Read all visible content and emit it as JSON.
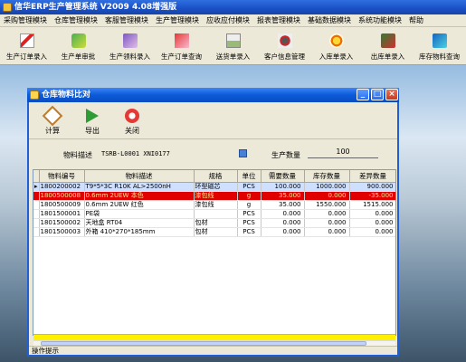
{
  "app": {
    "title": "信华ERP生产管理系统  V2009 4.08增强版"
  },
  "menu": [
    "采购管理模块",
    "仓库管理模块",
    "客服管理模块",
    "生产管理模块",
    "应收应付模块",
    "报表管理模块",
    "基础数据模块",
    "系统功能模块",
    "帮助"
  ],
  "toolbar": [
    {
      "label": "生产订单录入",
      "icon": "document-pen-icon"
    },
    {
      "label": "生产单审批",
      "icon": "approve-icon"
    },
    {
      "label": "生产领料录入",
      "icon": "material-icon"
    },
    {
      "label": "生产订单查询",
      "icon": "order-search-icon"
    },
    {
      "label": "送货单录入",
      "icon": "delivery-icon"
    },
    {
      "label": "客户信息管理",
      "icon": "customer-icon"
    },
    {
      "label": "入库单录入",
      "icon": "inbound-icon"
    },
    {
      "label": "出库单录入",
      "icon": "outbound-icon"
    },
    {
      "label": "库存物料查询",
      "icon": "inventory-search-icon"
    }
  ],
  "window": {
    "title": "仓库物料比对",
    "buttons": {
      "calc": "计算",
      "export": "导出",
      "close": "关闭"
    },
    "filter": {
      "label": "物料描述",
      "value": "TSRB-L0001    XNI0177",
      "qty_label": "生产数量",
      "qty_value": "100"
    },
    "columns": [
      "物料编号",
      "物料描述",
      "规格",
      "单位",
      "需要数量",
      "库存数量",
      "差异数量"
    ],
    "rows": [
      [
        "1800200002",
        "T9*5*3C  R10K    AL>2500nH",
        "环型磁芯",
        "PCS",
        "100.000",
        "1000.000",
        "900.000"
      ],
      [
        "1800500008",
        "0.6mm   2UEW  本色",
        "漆包线",
        "g",
        "35.000",
        "0.000",
        "-35.000"
      ],
      [
        "1800500009",
        "0.6mm   2UEW  红色",
        "漆包线",
        "g",
        "35.000",
        "1550.000",
        "1515.000"
      ],
      [
        "1801500001",
        "PE袋",
        "",
        "PCS",
        "0.000",
        "0.000",
        "0.000"
      ],
      [
        "1801500002",
        "天地盒 RT04",
        "包材",
        "PCS",
        "0.000",
        "0.000",
        "0.000"
      ],
      [
        "1801500003",
        "外箱  410*270*185mm",
        "包材",
        "PCS",
        "0.000",
        "0.000",
        "0.000"
      ]
    ],
    "status": "操作提示"
  }
}
